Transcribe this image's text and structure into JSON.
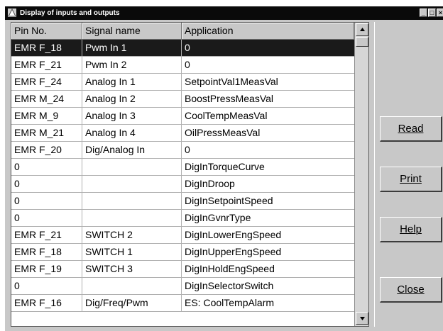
{
  "window": {
    "title": "Display of inputs and outputs",
    "controls": {
      "minimize": "_",
      "maximize": "□",
      "close": "×"
    }
  },
  "table": {
    "headers": [
      "Pin No.",
      "Signal name",
      "Application"
    ],
    "selected_row": 0,
    "rows": [
      [
        "EMR F_18",
        "Pwm In 1",
        "0"
      ],
      [
        "EMR F_21",
        "Pwm In 2",
        "0"
      ],
      [
        "EMR F_24",
        "Analog In 1",
        "SetpointVal1MeasVal"
      ],
      [
        "EMR M_24",
        "Analog In 2",
        "BoostPressMeasVal"
      ],
      [
        "EMR M_9",
        "Analog In 3",
        "CoolTempMeasVal"
      ],
      [
        "EMR M_21",
        "Analog In 4",
        "OilPressMeasVal"
      ],
      [
        "EMR F_20",
        "Dig/Analog In",
        "0"
      ],
      [
        "0",
        "",
        "DigInTorqueCurve"
      ],
      [
        "0",
        "",
        "DigInDroop"
      ],
      [
        "0",
        "",
        "DigInSetpointSpeed"
      ],
      [
        "0",
        "",
        "DigInGvnrType"
      ],
      [
        "EMR F_21",
        "SWITCH 2",
        "DigInLowerEngSpeed"
      ],
      [
        "EMR F_18",
        "SWITCH 1",
        "DigInUpperEngSpeed"
      ],
      [
        "EMR F_19",
        "SWITCH 3",
        "DigInHoldEngSpeed"
      ],
      [
        "0",
        "",
        "DigInSelectorSwitch"
      ],
      [
        "EMR F_16",
        "Dig/Freq/Pwm",
        "ES: CoolTempAlarm"
      ]
    ]
  },
  "buttons": {
    "read": "Read",
    "print": "Print",
    "help": "Help",
    "close": "Close"
  },
  "icons": {
    "app": "app-icon",
    "scroll_up": "arrow-up-icon",
    "scroll_down": "arrow-down-icon"
  }
}
